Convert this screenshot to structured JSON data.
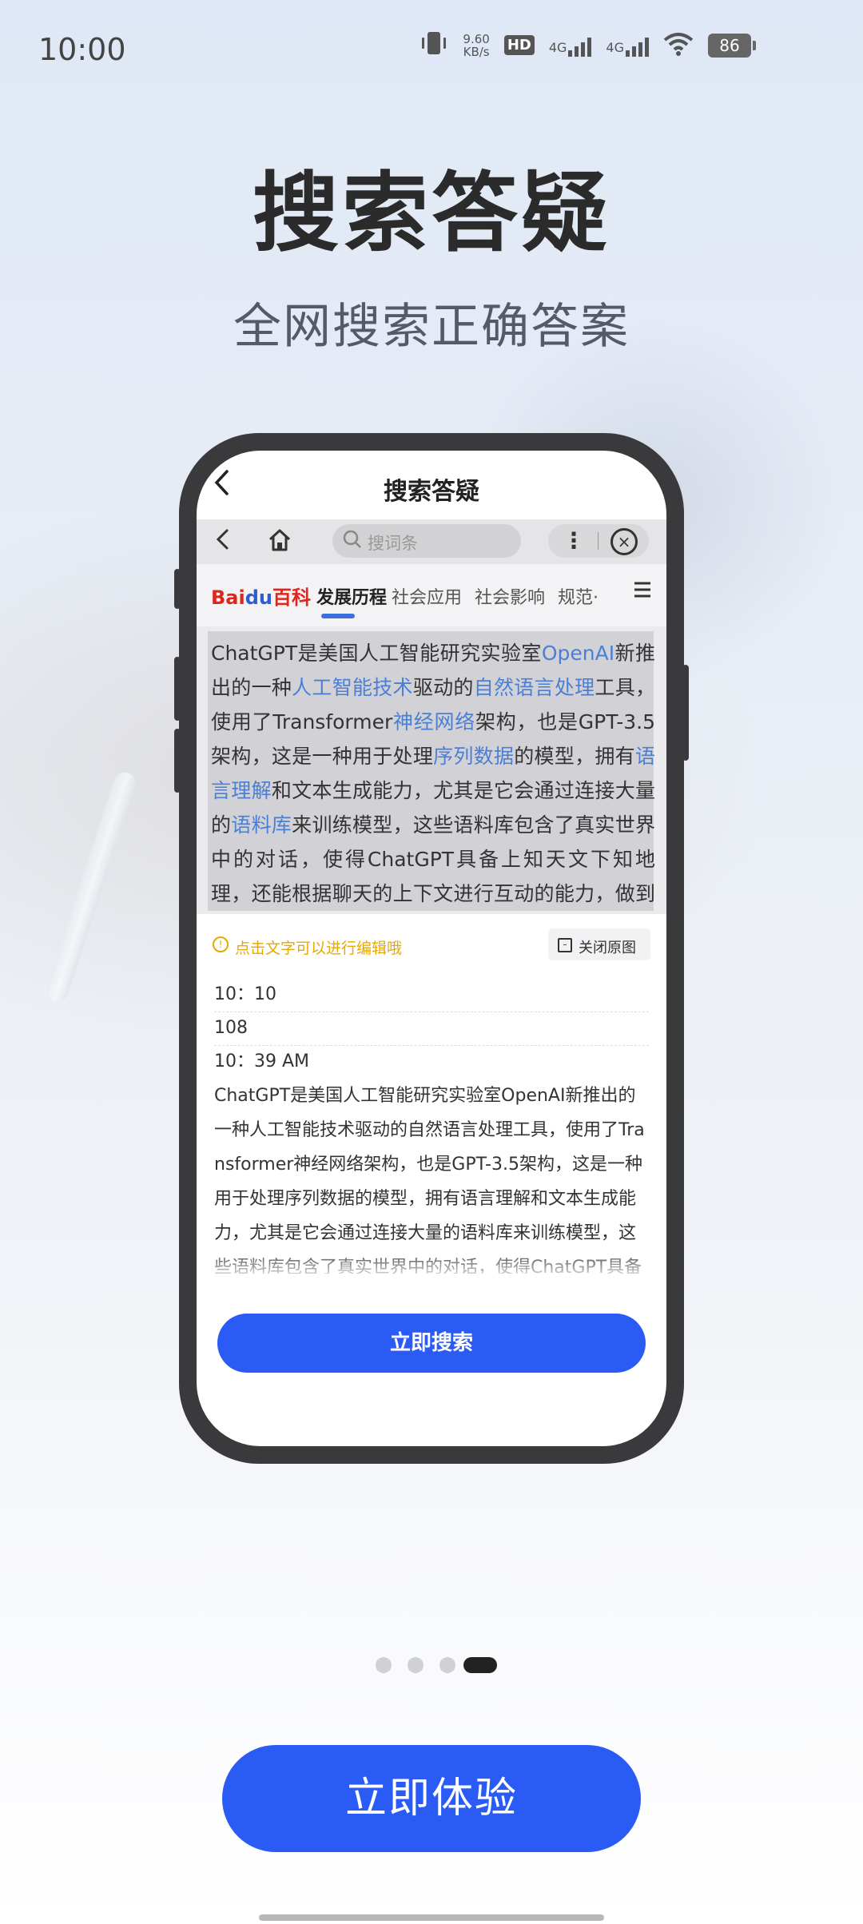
{
  "status_bar": {
    "time": "10:00",
    "net_speed_value": "9.60",
    "net_speed_unit": "KB/s",
    "hd": "HD",
    "sim1": "4G",
    "sim2": "4G",
    "battery": "86"
  },
  "hero": {
    "title": "搜索答疑",
    "subtitle": "全网搜索正确答案"
  },
  "phone_screen": {
    "header_title": "搜索答疑",
    "browser": {
      "search_placeholder": "搜词条"
    },
    "tabs": {
      "logo_bai": "Bai",
      "logo_du": "du",
      "logo_baike": "百科",
      "items": [
        "发展历程",
        "社会应用",
        "社会影响",
        "规范·"
      ]
    },
    "source_text": {
      "segments": [
        {
          "t": "ChatGPT是美国人工智能研究实验室",
          "link": false
        },
        {
          "t": "OpenAI",
          "link": true
        },
        {
          "t": "新推出的一种",
          "link": false
        },
        {
          "t": "人工智能技术",
          "link": true
        },
        {
          "t": "驱动的",
          "link": false
        },
        {
          "t": "自然语言处理",
          "link": true
        },
        {
          "t": "工具，使用了Transformer",
          "link": false
        },
        {
          "t": "神经网络",
          "link": true
        },
        {
          "t": "架构，也是GPT-3.5架构，这是一种用于处理",
          "link": false
        },
        {
          "t": "序列数据",
          "link": true
        },
        {
          "t": "的模型，拥有",
          "link": false
        },
        {
          "t": "语言理解",
          "link": true
        },
        {
          "t": "和文本生成能力，尤其是它会通过连接大量的",
          "link": false
        },
        {
          "t": "语料库",
          "link": true
        },
        {
          "t": "来训练模型，这些语料库包含了真实世界中的对话，使得ChatGPT具备上知天文下知地理，还能根据聊天的上下文进行互动的能力，做到与真正人类几乎无异的聊天场景进行交流。",
          "link": false
        }
      ]
    },
    "hint": "点击文字可以进行编辑哦",
    "close_original": "关闭原图",
    "ocr": {
      "line1": "10：10",
      "line2": "108",
      "line3": "10：39 AM",
      "paragraph": "ChatGPT是美国人工智能研究实验室OpenAI新推出的一种人工智能技术驱动的自然语言处理工具，使用了Transformer神经网络架构，也是GPT-3.5架构，这是一种用于处理序列数据的模型，拥有语言理解和文本生成能力，尤其是它会通过连接大量的语料库来训练模型，这些语料库包含了真实世界中的对话，使得ChatGPT具备上知天文下知地理，还能根据聊天的上下文进行互动的能力，做到与真正人类几乎无异的聊天场景进行交流。ChatGPT不单"
    },
    "search_button": "立即搜索"
  },
  "pager": {
    "count": 4,
    "active_index": 3
  },
  "cta_button": "立即体验",
  "colors": {
    "accent": "#2a5cf5",
    "link": "#4a7fd6",
    "hint": "#e8a800"
  }
}
